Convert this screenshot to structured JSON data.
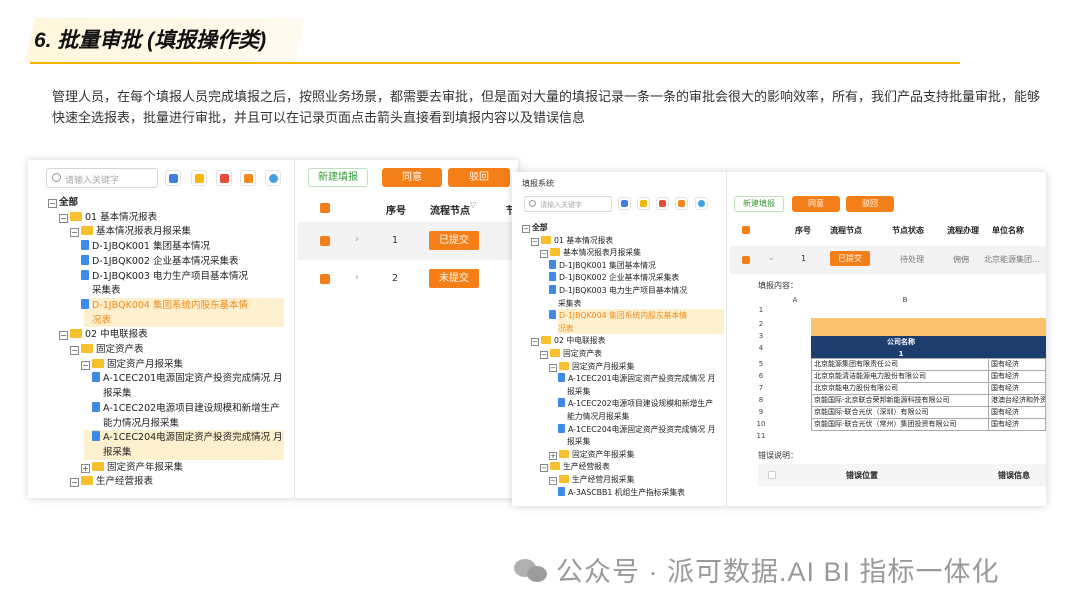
{
  "slide": {
    "title": "6. 批量审批 (填报操作类)",
    "paragraph": "管理人员，在每个填报人员完成填报之后，按照业务场景，都需要去审批，但是面对大量的填报记录一条一条的审批会很大的影响效率，所有，我们产品支持批量审批，能够快速全选报表，批量进行审批，并且可以在记录页面点击箭头直接看到填报内容以及错误信息",
    "watermark": "公众号 · 派可数据.AI BI 指标一体化"
  },
  "left_app": {
    "search_placeholder": "请输入关键字",
    "tree": [
      {
        "label": "全部",
        "indent": 0,
        "icon": "none",
        "expander": "minus"
      },
      {
        "label": "01 基本情况报表",
        "indent": 1,
        "icon": "folder",
        "expander": "minus"
      },
      {
        "label": "基本情况报表月报采集",
        "indent": 2,
        "icon": "folder",
        "expander": "minus"
      },
      {
        "label": "D-1JBQK001 集团基本情况",
        "indent": 3,
        "icon": "doc",
        "expander": "none"
      },
      {
        "label": "D-1JBQK002 企业基本情况采集表",
        "indent": 3,
        "icon": "doc",
        "expander": "none"
      },
      {
        "label": "D-1JBQK003 电力生产项目基本情况",
        "indent": 3,
        "icon": "doc",
        "expander": "none"
      },
      {
        "label": "采集表",
        "indent": 4,
        "icon": "none",
        "expander": "none"
      },
      {
        "label": "D-1JBQK004 集团系统内股东基本情",
        "indent": 3,
        "icon": "doc",
        "expander": "none",
        "highlight": true,
        "orange": true
      },
      {
        "label": "况表",
        "indent": 4,
        "icon": "none",
        "expander": "none",
        "highlight": true,
        "orange": true
      },
      {
        "label": "02 中电联报表",
        "indent": 1,
        "icon": "folder",
        "expander": "minus"
      },
      {
        "label": "固定资产表",
        "indent": 2,
        "icon": "folder",
        "expander": "minus"
      },
      {
        "label": "固定资产月报采集",
        "indent": 3,
        "icon": "folder",
        "expander": "minus"
      },
      {
        "label": "A-1CEC201电源固定资产投资完成情况 月",
        "indent": 4,
        "icon": "doc",
        "expander": "none"
      },
      {
        "label": "报采集",
        "indent": 5,
        "icon": "none",
        "expander": "none"
      },
      {
        "label": "A-1CEC202电源项目建设规模和新增生产",
        "indent": 4,
        "icon": "doc",
        "expander": "none"
      },
      {
        "label": "能力情况月报采集",
        "indent": 5,
        "icon": "none",
        "expander": "none"
      },
      {
        "label": "A-1CEC204电源固定资产投资完成情况 月",
        "indent": 4,
        "icon": "doc",
        "expander": "none",
        "highlight": true
      },
      {
        "label": "报采集",
        "indent": 5,
        "icon": "none",
        "expander": "none",
        "highlight": true
      },
      {
        "label": "固定资产年报采集",
        "indent": 3,
        "icon": "folder",
        "expander": "plus"
      },
      {
        "label": "生产经营报表",
        "indent": 2,
        "icon": "folder",
        "expander": "minus"
      }
    ],
    "buttons": {
      "new": "新建填报",
      "approve": "同意",
      "reject": "驳回"
    },
    "columns": [
      "序号",
      "流程节点",
      "节"
    ],
    "rows": [
      {
        "no": "1",
        "status": "已提交"
      },
      {
        "no": "2",
        "status": "未提交"
      }
    ]
  },
  "right_app": {
    "header": "填报系统",
    "search_placeholder": "请输入关键字",
    "tree": [
      {
        "label": "全部",
        "indent": 0,
        "icon": "none",
        "expander": "minus"
      },
      {
        "label": "01 基本情况报表",
        "indent": 1,
        "icon": "folder",
        "expander": "minus"
      },
      {
        "label": "基本情况报表月报采集",
        "indent": 2,
        "icon": "folder",
        "expander": "minus"
      },
      {
        "label": "D-1JBQK001 集团基本情况",
        "indent": 3,
        "icon": "doc",
        "expander": "none"
      },
      {
        "label": "D-1JBQK002 企业基本情况采集表",
        "indent": 3,
        "icon": "doc",
        "expander": "none"
      },
      {
        "label": "D-1JBQK003 电力生产项目基本情况",
        "indent": 3,
        "icon": "doc",
        "expander": "none"
      },
      {
        "label": "采集表",
        "indent": 4,
        "icon": "none",
        "expander": "none"
      },
      {
        "label": "D-1JBQK004 集团系统内股东基本情",
        "indent": 3,
        "icon": "doc",
        "expander": "none",
        "highlight": true,
        "orange": true
      },
      {
        "label": "况表",
        "indent": 4,
        "icon": "none",
        "expander": "none",
        "highlight": true,
        "orange": true
      },
      {
        "label": "02 中电联报表",
        "indent": 1,
        "icon": "folder",
        "expander": "minus"
      },
      {
        "label": "固定资产表",
        "indent": 2,
        "icon": "folder",
        "expander": "minus"
      },
      {
        "label": "固定资产月报采集",
        "indent": 3,
        "icon": "folder",
        "expander": "minus"
      },
      {
        "label": "A-1CEC201电源固定资产投资完成情况 月",
        "indent": 4,
        "icon": "doc",
        "expander": "none"
      },
      {
        "label": "报采集",
        "indent": 5,
        "icon": "none",
        "expander": "none"
      },
      {
        "label": "A-1CEC202电源项目建设规模和新增生产",
        "indent": 4,
        "icon": "doc",
        "expander": "none"
      },
      {
        "label": "能力情况月报采集",
        "indent": 5,
        "icon": "none",
        "expander": "none"
      },
      {
        "label": "A-1CEC204电源固定资产投资完成情况 月",
        "indent": 4,
        "icon": "doc",
        "expander": "none"
      },
      {
        "label": "报采集",
        "indent": 5,
        "icon": "none",
        "expander": "none"
      },
      {
        "label": "固定资产年报采集",
        "indent": 3,
        "icon": "folder",
        "expander": "plus"
      },
      {
        "label": "生产经营报表",
        "indent": 2,
        "icon": "folder",
        "expander": "minus"
      },
      {
        "label": "生产经营月报采集",
        "indent": 3,
        "icon": "folder",
        "expander": "minus"
      },
      {
        "label": "A-3ASCBB1 机组生产指标采集表",
        "indent": 4,
        "icon": "doc",
        "expander": "none"
      }
    ],
    "buttons": {
      "new": "新建填报",
      "approve": "同意",
      "reject": "驳回"
    },
    "columns": [
      "序号",
      "流程节点",
      "节点状态",
      "流程办理",
      "单位名称"
    ],
    "row": {
      "no": "1",
      "status": "已提交",
      "node_state": "待处理",
      "handler": "佣佣",
      "unit": "北京能源集团..."
    },
    "content_label": "填报内容：",
    "sheet": {
      "col_a": "A",
      "col_b": "B",
      "header_label": "公司名称",
      "header_no": "1",
      "rows": [
        {
          "n": "1",
          "name": "",
          "type": ""
        },
        {
          "n": "2",
          "name": "",
          "type": ""
        },
        {
          "n": "3",
          "name": "",
          "type": ""
        },
        {
          "n": "4",
          "name": "",
          "type": ""
        },
        {
          "n": "5",
          "name": "北京能源集团有限责任公司",
          "type": "国有经济"
        },
        {
          "n": "6",
          "name": "北京京能清洁能源电力股份有限公司",
          "type": "国有经济"
        },
        {
          "n": "7",
          "name": "北京京能电力股份有限公司",
          "type": "国有经济"
        },
        {
          "n": "8",
          "name": "京能国际-北京联合荣邦新能源科技有限公司",
          "type": "港澳台经济和外资"
        },
        {
          "n": "9",
          "name": "京能国际-联合光伏（深圳）有限公司",
          "type": "国有经济"
        },
        {
          "n": "10",
          "name": "京能国际-联合光伏（常州）集团投资有限公司",
          "type": "国有经济"
        },
        {
          "n": "11",
          "name": "",
          "type": ""
        }
      ]
    },
    "error_label": "错误说明：",
    "error_columns": [
      "错误位置",
      "错误信息"
    ]
  }
}
